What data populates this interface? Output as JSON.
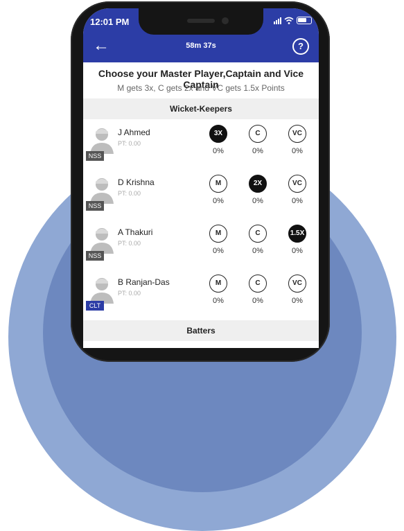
{
  "status_bar": {
    "time": "12:01 PM"
  },
  "header": {
    "back_icon": "arrow-left-icon",
    "timer": "58m 37s",
    "help_icon": "question-mark-icon"
  },
  "instructions": {
    "title": "Choose your Master Player,Captain and Vice Captain",
    "subtitle": "M gets 3x, C gets 2x and VC gets 1.5x Points"
  },
  "sections": [
    {
      "label": "Wicket-Keepers"
    },
    {
      "label": "Batters"
    }
  ],
  "players": [
    {
      "name": "J Ahmed",
      "points": "PT: 0.00",
      "team": "NSS",
      "team_color": "#555555",
      "m": "3X",
      "c": "C",
      "vc": "VC",
      "m_pct": "0%",
      "c_pct": "0%",
      "vc_pct": "0%",
      "selected": "m"
    },
    {
      "name": "D Krishna",
      "points": "PT: 0.00",
      "team": "NSS",
      "team_color": "#555555",
      "m": "M",
      "c": "2X",
      "vc": "VC",
      "m_pct": "0%",
      "c_pct": "0%",
      "vc_pct": "0%",
      "selected": "c"
    },
    {
      "name": "A Thakuri",
      "points": "PT: 0.00",
      "team": "NSS",
      "team_color": "#555555",
      "m": "M",
      "c": "C",
      "vc": "1.5X",
      "m_pct": "0%",
      "c_pct": "0%",
      "vc_pct": "0%",
      "selected": "vc"
    },
    {
      "name": "B Ranjan-Das",
      "points": "PT: 0.00",
      "team": "CLT",
      "team_color": "#2c3da6",
      "m": "M",
      "c": "C",
      "vc": "VC",
      "m_pct": "0%",
      "c_pct": "0%",
      "vc_pct": "0%",
      "selected": ""
    }
  ],
  "colors": {
    "header": "#2c3da6",
    "selected": "#111111",
    "backdrop": "#8fa8d4"
  }
}
